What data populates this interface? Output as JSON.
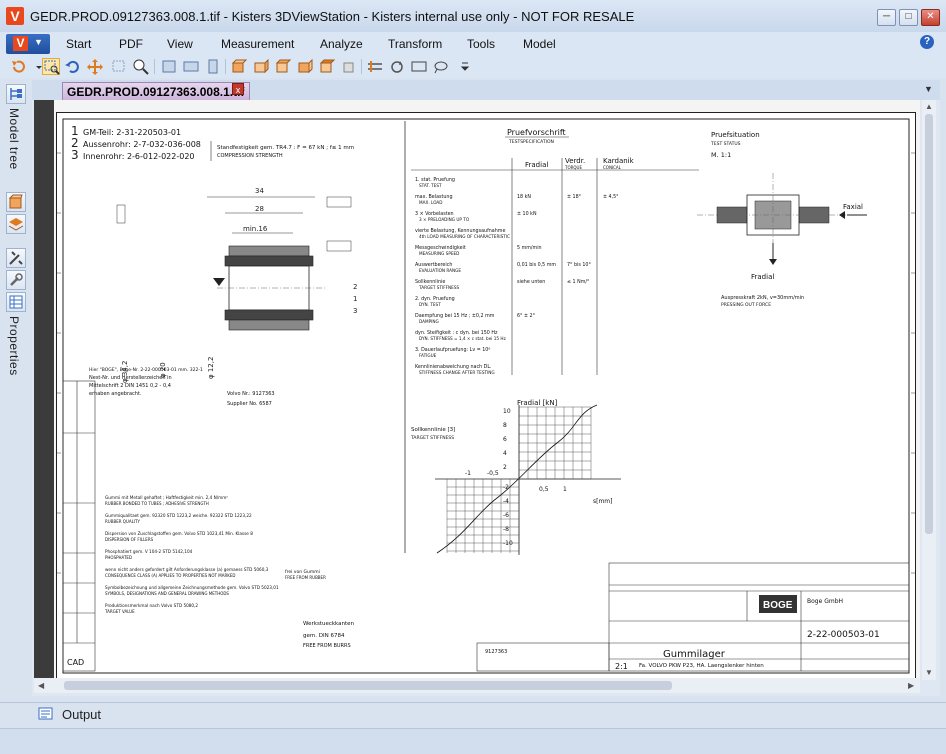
{
  "window": {
    "title": "GEDR.PROD.09127363.008.1.tif - Kisters 3DViewStation - Kisters internal use only - NOT FOR RESALE",
    "logo_letter": "V"
  },
  "menu": {
    "app_button_letter": "V",
    "items": [
      {
        "label": "Start"
      },
      {
        "label": "PDF"
      },
      {
        "label": "View"
      },
      {
        "label": "Measurement"
      },
      {
        "label": "Analyze"
      },
      {
        "label": "Transform"
      },
      {
        "label": "Tools"
      },
      {
        "label": "Model"
      }
    ],
    "help": "?"
  },
  "sidebar": {
    "top_label": "Model tree",
    "bottom_label": "Properties"
  },
  "document": {
    "tab_label": "GEDR.PROD.09127363.008.1.tif",
    "close_glyph": "x"
  },
  "output_panel": {
    "label": "Output"
  },
  "drawing": {
    "header_lines": [
      {
        "num": "1",
        "text": "GM-Teil: 2-31-220503-01"
      },
      {
        "num": "2",
        "text": "Aussenrohr: 2-7-032-036-008"
      },
      {
        "num": "3",
        "text": "Innenrohr: 2-6-012-022-020"
      }
    ],
    "strength_note": "Standfestigkeit gem. TR4.7 : F = 67 kN ; f≤ 1 mm",
    "strength_note_en": "COMPRESSION STRENGTH",
    "test_spec_title": "Pruefvorschrift",
    "test_spec_sub": "TESTSPECIFICATION",
    "test_situation_title": "Pruefsituation",
    "test_situation_sub": "TEST STATUS",
    "scale": "M. 1:1",
    "col_radial": "Fradial",
    "col_torque": "Verdr.",
    "col_torque_en": "TORQUE",
    "col_conical": "Kardanik",
    "col_conical_en": "CONICAL",
    "spec_rows": [
      {
        "de": "1. stat. Pruefung",
        "en": "STAT. TEST",
        "radial": "",
        "torque": "",
        "conical": ""
      },
      {
        "de": "max. Belastung",
        "en": "MAX. LOAD",
        "radial": "18 kN",
        "torque": "± 18°",
        "conical": "± 4,5°"
      },
      {
        "de": "3 × Vorbelasten",
        "en": "3 × PRELOADING UP TO",
        "radial": "± 10 kN",
        "torque": "",
        "conical": ""
      },
      {
        "de": "vierte Belastung, Kennungsaufnahme",
        "en": "4th LOAD MEASURING OF CHARACTERISTIC",
        "radial": "",
        "torque": "",
        "conical": ""
      },
      {
        "de": "Messgeschwindigkeit",
        "en": "MEASURING SPEED",
        "radial": "5 mm/min",
        "torque": "",
        "conical": ""
      },
      {
        "de": "Auswertbereich",
        "en": "EVALUATION RANGE",
        "radial": "0,01 bis 0,5 mm",
        "torque": "7° bis 10°",
        "conical": ""
      },
      {
        "de": "Sollkennlinie",
        "en": "TARGET STIFFNESS",
        "radial": "siehe unten",
        "torque": "≤ 1 Nm/°",
        "conical": ""
      },
      {
        "de": "2. dyn. Pruefung",
        "en": "DYN. TEST",
        "radial": "",
        "torque": "",
        "conical": ""
      },
      {
        "de": "Daempfung bei 15 Hz ; ±0,2 mm",
        "en": "DAMPING",
        "radial": "6° ± 2°",
        "torque": "",
        "conical": ""
      },
      {
        "de": "dyn. Steifigkeit : c dyn. bei 150 Hz",
        "en": "DYN. STIFFNESS = 1,4 × c stat. bei 15 Hz",
        "radial": "",
        "torque": "",
        "conical": ""
      },
      {
        "de": "3. Dauerlaufpruefung: Lv = 10⁶",
        "en": "FATIGUE",
        "radial": "",
        "torque": "",
        "conical": ""
      },
      {
        "de": "Kennlinienabweichung nach DL.",
        "en": "STIFFNESS CHANGE AFTER TESTING",
        "radial": "",
        "torque": "",
        "conical": ""
      }
    ],
    "chart_title": "Fradial [kN]",
    "chart_xlabel": "s[mm]",
    "chart_target": "Sollkennlinie [3]",
    "chart_target_en": "TARGET STIFFNESS",
    "chart_y_ticks": [
      "10",
      "8",
      "6",
      "4",
      "2",
      "-2",
      "-4",
      "-6",
      "-8",
      "-10"
    ],
    "chart_x_ticks": [
      "-1",
      "-0,5",
      "0,5",
      "1"
    ],
    "dims": {
      "d34": "34",
      "d28": "28",
      "min16": "min.16",
      "d342": "φ 34,2",
      "d20": "φ 20",
      "d122": "φ 12,2"
    },
    "notes_left": [
      "Gummi mit Metall gehaftet ; Haftfestigkeit min. 2,4 N/mm²",
      "RUBBER BONDED TO TUBES ; ADHESIVE STRENGTH",
      "Gummiqualitaet gem. 92320 STD 1223,2 weiche. 92322 STD 1223,22",
      "RUBBER QUALITY",
      "Dispersion von Zuschlagstoffen gem. Volvo STD 1023,41 Min. Klasse 8",
      "DISPERSION OF FILLERS",
      "Phosphatiert gem. V 104-2 STD 5142,104",
      "PHOSPHATED",
      "wenn nicht anders gefordert gilt Anforderungsklasse (a) gemaess STD 5060,3",
      "CONSEQUENCE CLASS (A) APPLIES TO PROPERTIES NOT MARKED",
      "Symbolbezeichnung und allgemeine Zeichnungsmethode gem. Volvo STD 5023,01",
      "SYMBOLS, DESIGNATIONS AND GENERAL DRAWING METHODS",
      "Produktionsmerkmal nach Volvo STD 5080,2",
      "TARGET VALUE"
    ],
    "title_block": {
      "company": "BOGE",
      "company_full": "Boge GmbH",
      "part_name": "Gummilager",
      "part_number": "2-22-000503-01",
      "customer": "Fa. VOLVO PKW P23, HA. Laengslenker hinten",
      "customer_no": "9127363",
      "scale": "2:1",
      "cad": "CAD"
    },
    "deburr": "Werkstueckkanten",
    "deburr2": "gem. DIN 6784",
    "deburr_en": "FREE FROM BURRS",
    "free_rubber": "frei von Gummi",
    "free_rubber_en": "FREE FROM RUBBER",
    "marking_text": "Hier \"BOGE\", Boge-Nr. 2-22-000503-01 mm. 322-1",
    "marking_text2": "Nest-Nr. und Herstellerzeichen in",
    "marking_text3": "Mittelschrift 2 DIN 1451 0,2 - 0,4",
    "marking_text4": "erhaben angebracht.",
    "volvo_label": "Volvo Nr.: 9127363",
    "supplier": "Supplier No. 6587",
    "radial_force_label": "Fradial",
    "axial_force_label": "Faxial",
    "pressout": "Auspresskraft 2kN, v=30mm/min",
    "pressout_en": "PRESSING OUT FORCE"
  }
}
